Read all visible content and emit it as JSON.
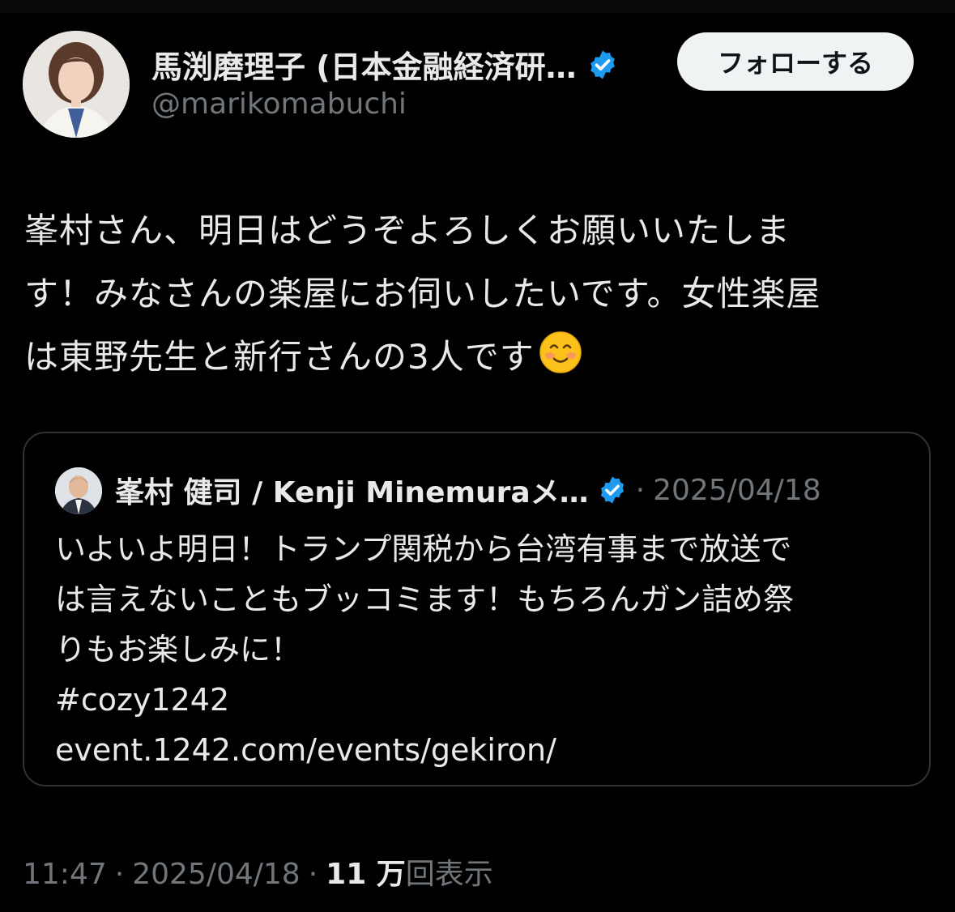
{
  "author": {
    "name": "馬渕磨理子 (日本金融経済研…",
    "handle": "@marikomabuchi",
    "verified_color": "#1d9bf0"
  },
  "follow_button": {
    "label": "フォローする"
  },
  "tweet": {
    "text": "峯村さん、明日はどうぞよろしくお願いいたしま\nす！みなさんの楽屋にお伺いしたいです。女性楽屋\nは東野先生と新行さんの3人です",
    "emoji": "smiling-face-emoji"
  },
  "quoted": {
    "author_name": "峯村 健司 / Kenji Minemuraメ…",
    "separator": "·",
    "date": "2025/04/18",
    "text": "いよいよ明日！トランプ関税から台湾有事まで放送で\nは言えないこともブッコミます！もちろんガン詰め祭\nりもお楽しみに！\n#cozy1242\nevent.1242.com/events/gekiron/"
  },
  "meta": {
    "time": "11:47",
    "sep1": "·",
    "date": "2025/04/18",
    "sep2": "·",
    "views_count": "11 万",
    "views_label": "回表示"
  }
}
